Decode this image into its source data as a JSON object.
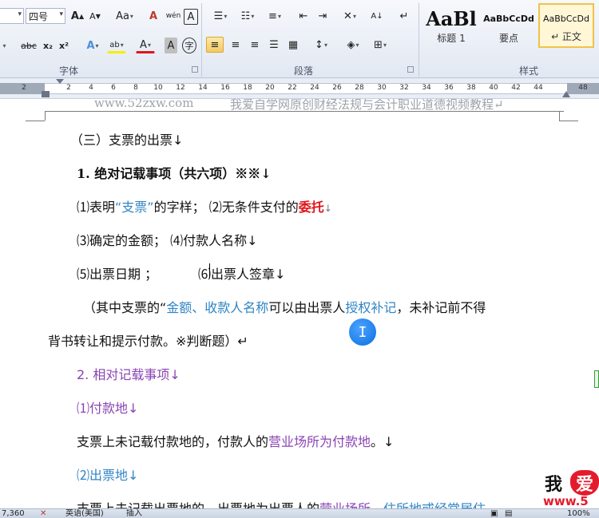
{
  "ribbon": {
    "font_size_value": "四号",
    "font_group_label": "字体",
    "paragraph_group_label": "段落",
    "styles_group_label": "样式",
    "font_buttons": {
      "grow": "A",
      "shrink": "A",
      "change_case": "Aa",
      "clear_format": "A",
      "phonetic": "wén",
      "char_border": "A",
      "strike": "abc",
      "subscript": "x₂",
      "superscript": "x²",
      "text_effect": "A",
      "highlight": "ab",
      "font_color": "A",
      "char_shading": "A",
      "enclose": "字"
    },
    "styles": [
      {
        "sample": "AaBl",
        "name": "标题 1"
      },
      {
        "sample": "AaBbCcDd",
        "name": "要点"
      },
      {
        "sample": "AaBbCcDd",
        "name": "↵ 正文"
      }
    ]
  },
  "ruler": {
    "numbers": [
      "2",
      "2",
      "4",
      "6",
      "8",
      "10",
      "12",
      "14",
      "16",
      "18",
      "20",
      "22",
      "24",
      "26",
      "28",
      "30",
      "32",
      "34",
      "36",
      "38",
      "40",
      "42",
      "44",
      "48"
    ]
  },
  "document": {
    "header_site": "www.52zxw.com",
    "header_title": "我爱自学网原创财经法规与会计职业道德视频教程↵",
    "lines": {
      "l1": "（三）支票的出票↓",
      "l2": "1. 绝对记载事项（共六项）※※↓",
      "l3_a": "⑴表明",
      "l3_b": "“支票”",
      "l3_c": "的字样；      ⑵无条件支付的",
      "l3_d": "委托",
      "l3_e": "↓",
      "l4": "⑶确定的金额；      ⑷付款人名称↓",
      "l5_a": "⑸出票日期 ；          ",
      "l5_b": "⑹出票人签章↓",
      "l6_a": "（其中支票的“",
      "l6_b": "金额、收款人名称",
      "l6_c": "可以由出票人",
      "l6_d": "授权补记",
      "l6_e": "，未补记前不得",
      "l7": "背书转让和提示付款。※判断题）↵",
      "l8": "2. 相对记载事项↓",
      "l9": "⑴付款地↓",
      "l10_a": "支票上未记载付款地的，付款人的",
      "l10_b": "营业场所为付款地",
      "l10_c": "。↓",
      "l11": "⑵出票地↓",
      "l12_a": "支票上未记载出票地的，出票地为出票人的",
      "l12_b": "营业场所",
      "l12_c": "、",
      "l12_d": "住所地或经常居住"
    },
    "watermark": {
      "wo": "我",
      "ai": "爱",
      "url": "www.5"
    }
  },
  "status_bar": {
    "words": "7,360",
    "language": "英语(美国)",
    "mode": "插入",
    "zoom": "100%"
  }
}
